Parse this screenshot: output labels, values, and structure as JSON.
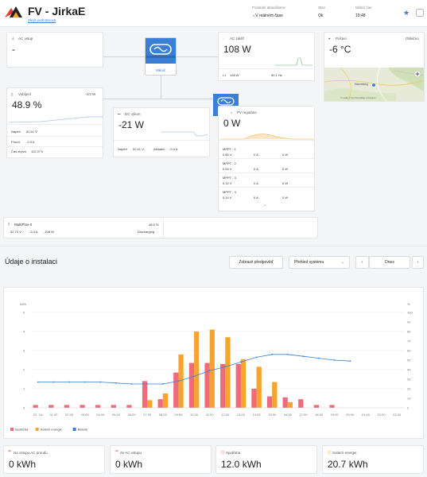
{
  "header": {
    "title": "FV - JirkaE",
    "subtitle": "Skrýt podrobnosti",
    "last_update_label": "Poslední aktualizace:",
    "last_update_value": "V reálném čase",
    "state_label": "Stav",
    "state_value": "Ok",
    "local_time_label": "Místní čas",
    "local_time_value": "19:48"
  },
  "ac_input": {
    "title": "AC vstup",
    "value": "-"
  },
  "ac_loads": {
    "title": "AC zátěž",
    "value": "108 W",
    "phase": "L1",
    "phase_power": "108 W",
    "frequency": "50.1 Hz"
  },
  "inverter": {
    "label": "Měnič"
  },
  "weather": {
    "title": "Počasí",
    "condition": "Oblačno",
    "value": "-6 °C",
    "map_city": "Nürnberg",
    "map_credit": "© Leaflet © OpenStreetMap contributors"
  },
  "battery": {
    "title": "Vybíjení",
    "time_left": "-1/3 W",
    "value": "48.9 %",
    "rows": [
      {
        "label": "Napětí",
        "value": "52.61 V"
      },
      {
        "label": "Proud",
        "value": "-2.9 A"
      },
      {
        "label": "Čas zbývá",
        "value": "112:37 h"
      }
    ]
  },
  "dc_system": {
    "title": "DC výkon",
    "value": "-21 W",
    "voltage_label": "Napětí",
    "voltage": "52.61 V",
    "current_label": "Aktuální",
    "current": "-0.4 A"
  },
  "pv_charger": {
    "title": "PV regulátor",
    "value": "0 W",
    "trackers": [
      {
        "name": "MPPT - 1",
        "voltage": "0.60 V",
        "current": "0 A",
        "power": "0 W"
      },
      {
        "name": "MPPT - 2",
        "voltage": "0.54 V",
        "current": "0 A",
        "power": "0 W"
      },
      {
        "name": "MPPT - 3",
        "voltage": "0.12 V",
        "current": "0 A",
        "power": "0 W"
      },
      {
        "name": "MPPT - 4",
        "voltage": "0.14 V",
        "current": "0 A",
        "power": "0 W"
      }
    ]
  },
  "multiplus": {
    "title": "MultiPlus-II",
    "soc": "48.5 %",
    "voltage": "52.70 V",
    "current": "-3.3 A",
    "power": "-108 W",
    "state": "Discharging"
  },
  "install": {
    "title": "Údaje o instalaci",
    "compare_label": "Zobrazit předpověď",
    "view_label": "Přehled systému",
    "date_label": "Dnes"
  },
  "chart_data": {
    "type": "bar",
    "left_axis_unit": "kWh",
    "right_axis_unit": "%",
    "left_ylim": [
      0,
      5
    ],
    "right_ylim": [
      0,
      100
    ],
    "left_ticks": [
      "0",
      "1",
      "2",
      "3",
      "4",
      "5"
    ],
    "right_ticks": [
      "0",
      "10",
      "20",
      "30",
      "40",
      "50",
      "60",
      "70",
      "80",
      "90",
      "100"
    ],
    "categories": [
      "22. Lis",
      "01:00",
      "02:00",
      "03:00",
      "04:00",
      "05:00",
      "06:00",
      "07:00",
      "08:00",
      "09:00",
      "10:00",
      "11:00",
      "12:00",
      "13:00",
      "14:00",
      "15:00",
      "16:00",
      "17:00",
      "18:00",
      "19:00",
      "20:00",
      "21:00",
      "22:00",
      "23:00"
    ],
    "series": [
      {
        "name": "Spotřeba",
        "color": "#f06a7a",
        "values": [
          0.15,
          0.15,
          0.15,
          0.15,
          0.15,
          0.15,
          0.15,
          1.4,
          0.45,
          1.85,
          2.35,
          2.35,
          2.3,
          2.3,
          1.0,
          0.6,
          0.55,
          0.45,
          0.15,
          0.15,
          0,
          0,
          0,
          0
        ]
      },
      {
        "name": "Solární energie",
        "color": "#f5a52f",
        "values": [
          0,
          0,
          0,
          0,
          0,
          0,
          0,
          0.4,
          0.75,
          2.8,
          4.0,
          4.1,
          3.7,
          2.55,
          2.15,
          1.35,
          0.3,
          0,
          0,
          0,
          0,
          0,
          0,
          0
        ]
      },
      {
        "name": "Baterie",
        "color": "#3a7fd5",
        "type": "line",
        "values": [
          27,
          27,
          27,
          27,
          27,
          26,
          25,
          25,
          25,
          28,
          33,
          39,
          43,
          48,
          53,
          56,
          56,
          54,
          52,
          50,
          49
        ]
      }
    ]
  },
  "tiles": [
    {
      "label": "Na vstupu AC proudu",
      "value": "0 kWh",
      "color": "#f06a7a"
    },
    {
      "label": "Ze AC vstupu",
      "value": "0 kWh",
      "color": "#f06a7a"
    },
    {
      "label": "Spotřeba",
      "value": "12.0 kWh",
      "color": "#f06a7a"
    },
    {
      "label": "Solární energie",
      "value": "20.7 kWh",
      "color": "#f5a52f"
    }
  ]
}
